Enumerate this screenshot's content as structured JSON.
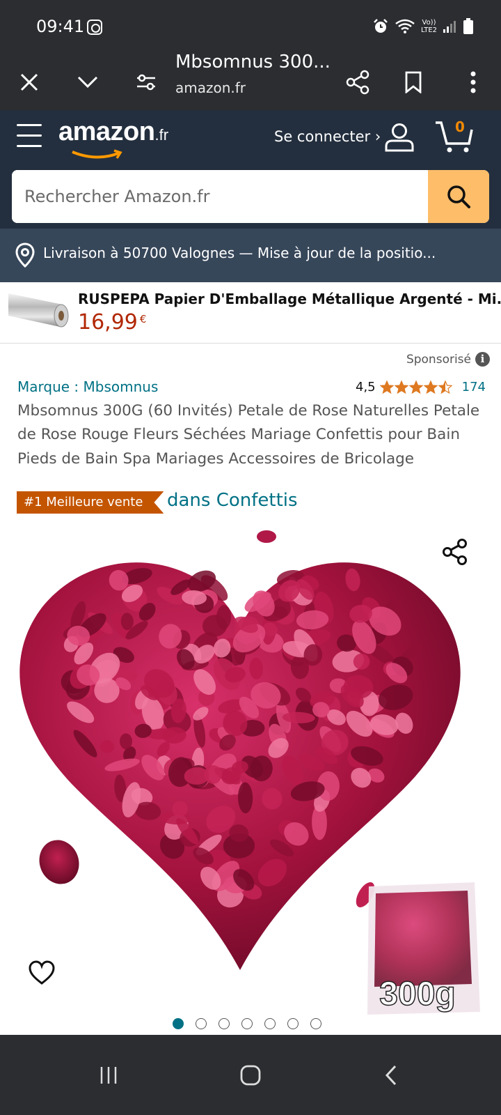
{
  "status_bar": {
    "time": "09:41",
    "icons": [
      "instagram-icon",
      "alarm-icon",
      "wifi-icon",
      "volte-icon",
      "signal-icon",
      "battery-icon"
    ],
    "network_label_1": "Vo))",
    "network_label_2": "LTE2"
  },
  "browser": {
    "page_title": "Mbsomnus 300...",
    "domain": "amazon.fr",
    "icons": [
      "close-icon",
      "chevron-down-icon",
      "tune-icon",
      "share-icon",
      "bookmark-icon",
      "more-vert-icon"
    ]
  },
  "header": {
    "logo_text": "amazon",
    "logo_tld": ".fr",
    "signin_label": "Se connecter ›",
    "cart_count": "0"
  },
  "search": {
    "placeholder": "Rechercher Amazon.fr"
  },
  "delivery": {
    "text": "Livraison à 50700 Valognes — Mise à jour de la positio..."
  },
  "ad": {
    "title": "RUSPEPA Papier D'Emballage Métallique Argenté - Mi...",
    "price": "16,99",
    "currency": "€"
  },
  "sponsored_label": "Sponsorisé",
  "product": {
    "brand": "Marque : Mbsomnus",
    "rating_value": "4,5",
    "rating_stars": 4.5,
    "review_count": "174",
    "title": "Mbsomnus 300G (60 Invités) Petale de Rose Naturelles Petale de Rose Rouge Fleurs Séchées Mariage Confettis pour Bain Pieds de Bain Spa Mariages Accessoires de Bricolage",
    "badge": "#1 Meilleure vente",
    "badge_category": "dans Confettis",
    "image_bag_label": "300g",
    "carousel_total": 7,
    "carousel_active": 1
  },
  "colors": {
    "status_bg": "#2b2d31",
    "amazon_header": "#232f3e",
    "delivery_bg": "#37475a",
    "search_button": "#febd69",
    "link": "#007185",
    "price": "#b12704",
    "badge": "#c45500",
    "star": "#de7921",
    "petal": "#a3123d"
  }
}
